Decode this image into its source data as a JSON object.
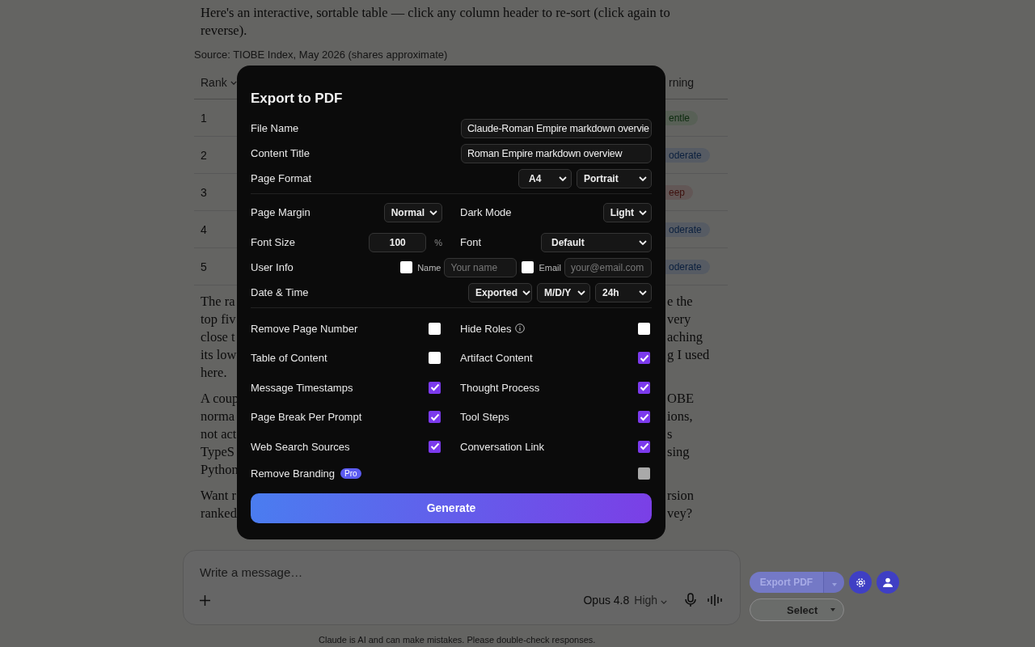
{
  "page": {
    "intro": "Here's an interactive, sortable table — click any column header to re-sort (click again to reverse).",
    "source": "Source: TIOBE Index, May 2026 (shares approximate)",
    "columns": [
      "Rank",
      "rning"
    ],
    "rows": [
      {
        "rank": "1",
        "tag": "entle",
        "kind": "gentle"
      },
      {
        "rank": "2",
        "tag": "oderate",
        "kind": "moderate"
      },
      {
        "rank": "3",
        "tag": "eep",
        "kind": "deep"
      },
      {
        "rank": "4",
        "tag": "oderate",
        "kind": "moderate"
      },
      {
        "rank": "5",
        "tag": "oderate",
        "kind": "moderate"
      }
    ],
    "paragraphs": [
      {
        "lines": [
          {
            "left": "The ra",
            "right": "e the"
          },
          {
            "left": "top fiv",
            "right": "very"
          },
          {
            "left": "close t",
            "right": "aching"
          },
          {
            "left": "its low",
            "right": "g I used"
          },
          {
            "left": "here."
          }
        ]
      },
      {
        "lines": [
          {
            "left": "A coup",
            "right": "OBE"
          },
          {
            "left": "norma",
            "right": "ions,"
          },
          {
            "left": "not act",
            "right": "s"
          },
          {
            "left": "TypeS",
            "right": "sing"
          },
          {
            "left": "Python"
          }
        ]
      },
      {
        "lines": [
          {
            "left": "Want r",
            "right": "rsion"
          },
          {
            "left": "ranked",
            "right": "vey?"
          }
        ]
      }
    ]
  },
  "composer": {
    "placeholder": "Write a message…",
    "model": "Opus 4.8",
    "effort": "High",
    "disclaimer": "Claude is AI and can make mistakes. Please double-check responses."
  },
  "extension": {
    "export_button": "Export PDF",
    "select": "Select"
  },
  "dialog": {
    "title": "Export to PDF",
    "fields": [
      {
        "label": "File Name",
        "value": "Claude-Roman Empire markdown overvie"
      },
      {
        "label": "Content Title",
        "value": "Roman Empire markdown overview"
      }
    ],
    "page_format": {
      "label": "Page Format",
      "selects": [
        "A4",
        "Portrait"
      ]
    },
    "page_margin": {
      "label": "Page Margin",
      "value": "Normal"
    },
    "dark_mode": {
      "label": "Dark Mode",
      "value": "Light"
    },
    "font_size": {
      "label": "Font Size",
      "value": "100",
      "unit": "%"
    },
    "font": {
      "label": "Font",
      "value": "Default"
    },
    "user_info": {
      "label": "User Info",
      "entries": [
        {
          "label": "Name",
          "checked": false,
          "placeholder": "Your name"
        },
        {
          "label": "Email",
          "checked": false,
          "placeholder": "your@email.com"
        }
      ]
    },
    "date_time": {
      "label": "Date & Time",
      "selects": [
        "Exported",
        "M/D/Y",
        "24h"
      ]
    },
    "toggles": [
      {
        "label": "Remove Page Number",
        "checked": false,
        "disabled": false
      },
      {
        "label": "Hide Roles",
        "checked": false,
        "disabled": false,
        "info": true
      },
      {
        "label": "Table of Content",
        "checked": false,
        "disabled": false
      },
      {
        "label": "Artifact Content",
        "checked": true,
        "disabled": false
      },
      {
        "label": "Message Timestamps",
        "checked": true,
        "disabled": false
      },
      {
        "label": "Thought Process",
        "checked": true,
        "disabled": false
      },
      {
        "label": "Page Break Per Prompt",
        "checked": true,
        "disabled": false
      },
      {
        "label": "Tool Steps",
        "checked": true,
        "disabled": false
      },
      {
        "label": "Web Search Sources",
        "checked": true,
        "disabled": false
      },
      {
        "label": "Conversation Link",
        "checked": true,
        "disabled": false
      },
      {
        "label": "Remove Branding",
        "checked": false,
        "disabled": true,
        "badge": "Pro"
      }
    ],
    "generate": "Generate"
  }
}
